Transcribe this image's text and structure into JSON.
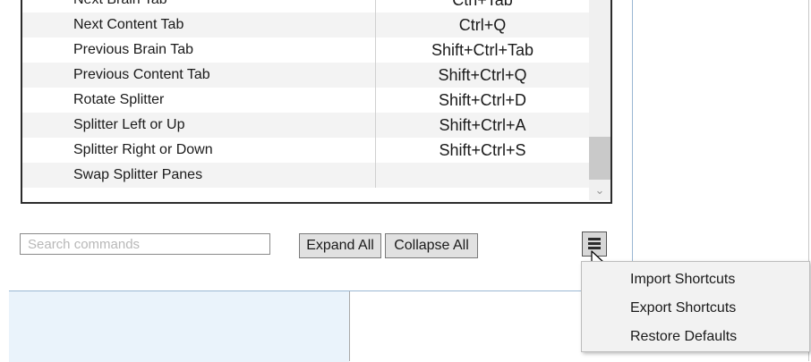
{
  "shortcuts": {
    "rows": [
      {
        "command": "Next Brain Tab",
        "key": "Ctrl+Tab"
      },
      {
        "command": "Next Content Tab",
        "key": "Ctrl+Q"
      },
      {
        "command": "Previous Brain Tab",
        "key": "Shift+Ctrl+Tab"
      },
      {
        "command": "Previous Content Tab",
        "key": "Shift+Ctrl+Q"
      },
      {
        "command": "Rotate Splitter",
        "key": "Shift+Ctrl+D"
      },
      {
        "command": "Splitter Left or Up",
        "key": "Shift+Ctrl+A"
      },
      {
        "command": "Splitter Right or Down",
        "key": "Shift+Ctrl+S"
      },
      {
        "command": "Swap Splitter Panes",
        "key": ""
      }
    ]
  },
  "search": {
    "placeholder": "Search commands",
    "value": ""
  },
  "buttons": {
    "expand_all": "Expand All",
    "collapse_all": "Collapse All"
  },
  "icons": {
    "menu": "hamburger-menu-icon",
    "cursor": "mouse-pointer-icon",
    "scroll_down": "chevron-down-icon"
  },
  "context_menu": {
    "items": [
      "Import Shortcuts",
      "Export Shortcuts",
      "Restore Defaults"
    ]
  }
}
